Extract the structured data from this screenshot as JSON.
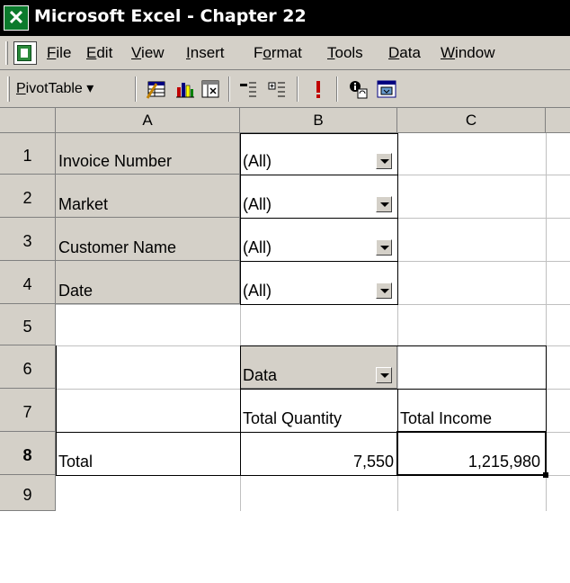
{
  "window": {
    "title": "Microsoft Excel - Chapter 22"
  },
  "menu": {
    "items": [
      {
        "pre": "",
        "u": "F",
        "post": "ile"
      },
      {
        "pre": "",
        "u": "E",
        "post": "dit"
      },
      {
        "pre": "",
        "u": "V",
        "post": "iew"
      },
      {
        "pre": "",
        "u": "I",
        "post": "nsert"
      },
      {
        "pre": "F",
        "u": "o",
        "post": "rmat"
      },
      {
        "pre": "",
        "u": "T",
        "post": "ools"
      },
      {
        "pre": "",
        "u": "D",
        "post": "ata"
      },
      {
        "pre": "",
        "u": "W",
        "post": "indow"
      }
    ]
  },
  "toolbar": {
    "pivot_u": "P",
    "pivot_rest": "ivotTable",
    "pivot_arrow": "▾",
    "icons": [
      "format-report-icon",
      "chart-wizard-icon",
      "pivot-wizard-icon",
      "hide-detail-icon",
      "show-detail-icon",
      "refresh-data-icon",
      "field-settings-icon",
      "show-field-list-icon"
    ]
  },
  "grid": {
    "columns": [
      "A",
      "B",
      "C"
    ],
    "rows": [
      "1",
      "2",
      "3",
      "4",
      "5",
      "6",
      "7",
      "8",
      "9"
    ],
    "page_fields": [
      {
        "label": "Invoice Number",
        "value": "(All)"
      },
      {
        "label": "Market",
        "value": "(All)"
      },
      {
        "label": "Customer Name",
        "value": "(All)"
      },
      {
        "label": "Date",
        "value": "(All)"
      }
    ],
    "data_field": "Data",
    "headers": {
      "quantity": "Total Quantity",
      "income": "Total Income"
    },
    "total": {
      "label": "Total",
      "quantity": "7,550",
      "income": "1,215,980"
    }
  },
  "colors": {
    "chrome": "#d4d0c8",
    "title_bg": "#000000",
    "excel_green": "#0b7a2c"
  }
}
